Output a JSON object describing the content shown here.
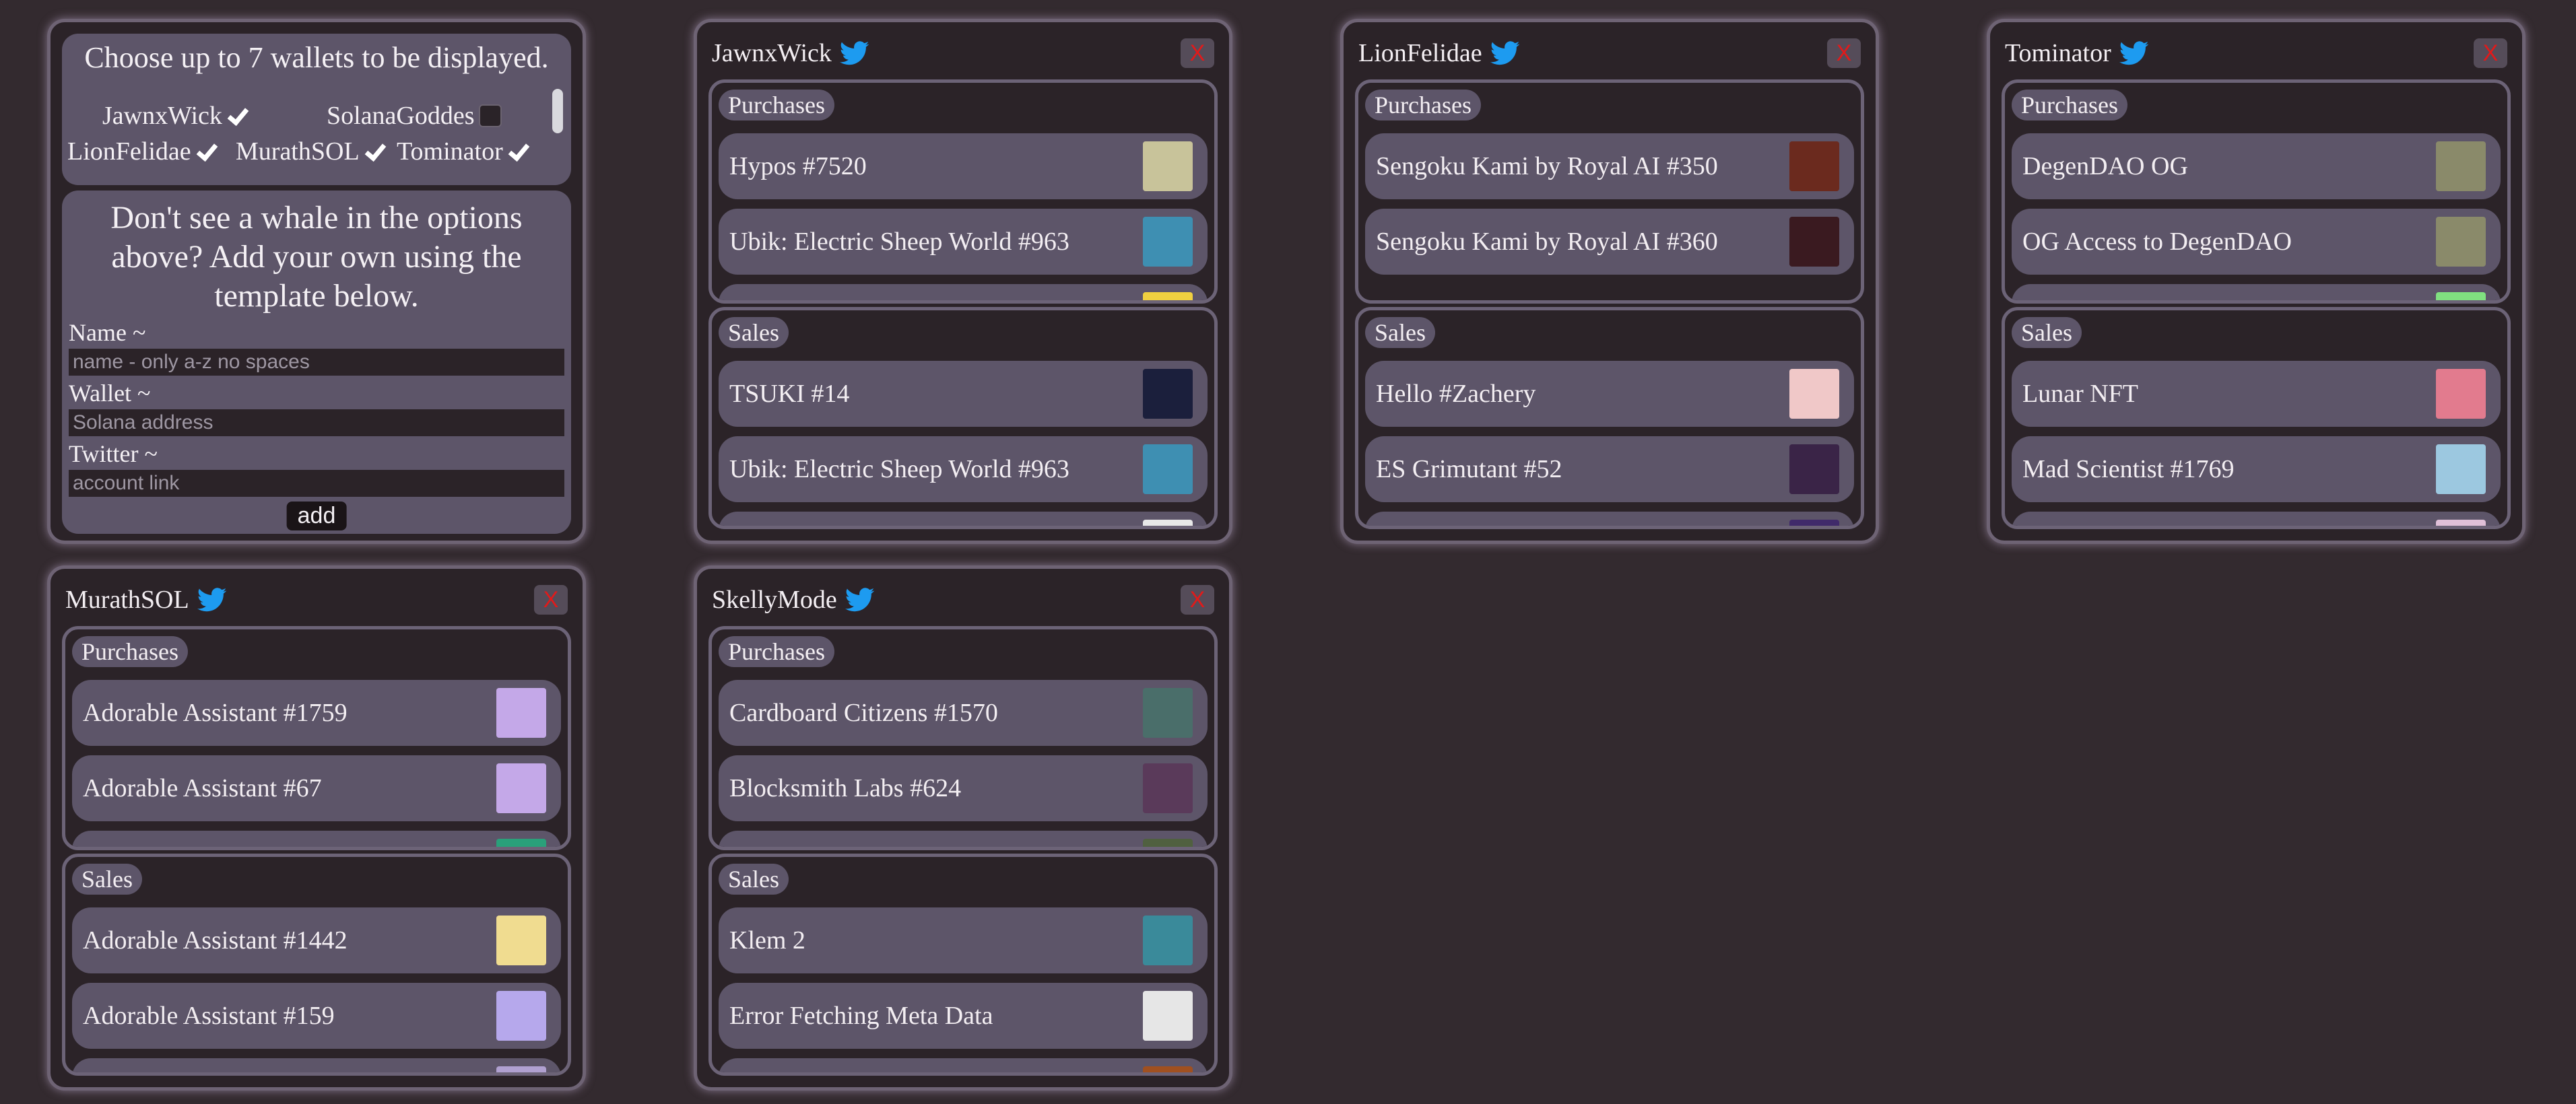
{
  "settings": {
    "choose_title": "Choose up to 7 wallets to be displayed.",
    "wallet_checks": [
      {
        "label": "JawnxWick",
        "checked": true
      },
      {
        "label": "SolanaGoddes",
        "checked": false
      },
      {
        "label": "LionFelidae",
        "checked": true
      },
      {
        "label": "MurathSOL",
        "checked": true
      },
      {
        "label": "Tominator",
        "checked": true
      }
    ],
    "add_heading": "Don't see a whale in the options above? Add your own using the template below.",
    "name_label": "Name ~",
    "name_placeholder": "name - only a-z no spaces",
    "wallet_label": "Wallet ~",
    "wallet_placeholder": "Solana address",
    "twitter_label": "Twitter ~",
    "twitter_placeholder": "account link",
    "add_button": "add"
  },
  "labels": {
    "purchases": "Purchases",
    "sales": "Sales",
    "close": "X"
  },
  "colors": {
    "twitter_blue": "#1d9bf0",
    "close_red": "#e11a1a",
    "card": "#5d5569",
    "panel": "#2b2328"
  },
  "wallets": [
    {
      "name": "JawnxWick",
      "purchases": [
        {
          "name": "Hypos #7520",
          "thumb_color": "#c8c39a"
        },
        {
          "name": "Ubik: Electric Sheep World #963",
          "thumb_color": "#3e8fb2"
        },
        {
          "name": "",
          "thumb_color": "#f0d040"
        }
      ],
      "sales": [
        {
          "name": "TSUKI #14",
          "thumb_color": "#1b1f3c"
        },
        {
          "name": "Ubik: Electric Sheep World #963",
          "thumb_color": "#3e8fb2"
        },
        {
          "name": "",
          "thumb_color": "#e8e8e8"
        }
      ]
    },
    {
      "name": "LionFelidae",
      "purchases": [
        {
          "name": "Sengoku Kami by Royal AI #350",
          "thumb_color": "#6b2a1e"
        },
        {
          "name": "Sengoku Kami by Royal AI #360",
          "thumb_color": "#3a1a20"
        }
      ],
      "sales": [
        {
          "name": "Hello #Zachery",
          "thumb_color": "#f0c8c8"
        },
        {
          "name": "ES Grimutant #52",
          "thumb_color": "#3a2447"
        },
        {
          "name": "",
          "thumb_color": "#402a6a"
        }
      ]
    },
    {
      "name": "Tominator",
      "purchases": [
        {
          "name": "DegenDAO OG",
          "thumb_color": "#8a8a6a"
        },
        {
          "name": "OG Access to DegenDAO",
          "thumb_color": "#8a8a6a"
        },
        {
          "name": "",
          "thumb_color": "#80e080"
        }
      ],
      "sales": [
        {
          "name": "Lunar NFT",
          "thumb_color": "#e27b8e"
        },
        {
          "name": "Mad Scientist #1769",
          "thumb_color": "#9cc8e0"
        },
        {
          "name": "",
          "thumb_color": "#e0c0d8"
        }
      ]
    },
    {
      "name": "MurathSOL",
      "purchases": [
        {
          "name": "Adorable Assistant #1759",
          "thumb_color": "#c4a8e8"
        },
        {
          "name": "Adorable Assistant #67",
          "thumb_color": "#c4a8e8"
        },
        {
          "name": "",
          "thumb_color": "#2aa07a"
        }
      ],
      "sales": [
        {
          "name": "Adorable Assistant #1442",
          "thumb_color": "#f0dc90"
        },
        {
          "name": "Adorable Assistant #159",
          "thumb_color": "#b6a8ec"
        },
        {
          "name": "",
          "thumb_color": "#b0a0d0"
        }
      ]
    },
    {
      "name": "SkellyMode",
      "purchases": [
        {
          "name": "Cardboard Citizens #1570",
          "thumb_color": "#4a6e6a"
        },
        {
          "name": "Blocksmith Labs #624",
          "thumb_color": "#5a3a5a"
        },
        {
          "name": "",
          "thumb_color": "#506040"
        }
      ],
      "sales": [
        {
          "name": "Klem 2",
          "thumb_color": "#3a8a9a"
        },
        {
          "name": "Error Fetching Meta Data",
          "thumb_color": "#e6e6e6"
        },
        {
          "name": "",
          "thumb_color": "#a05020"
        }
      ]
    }
  ]
}
